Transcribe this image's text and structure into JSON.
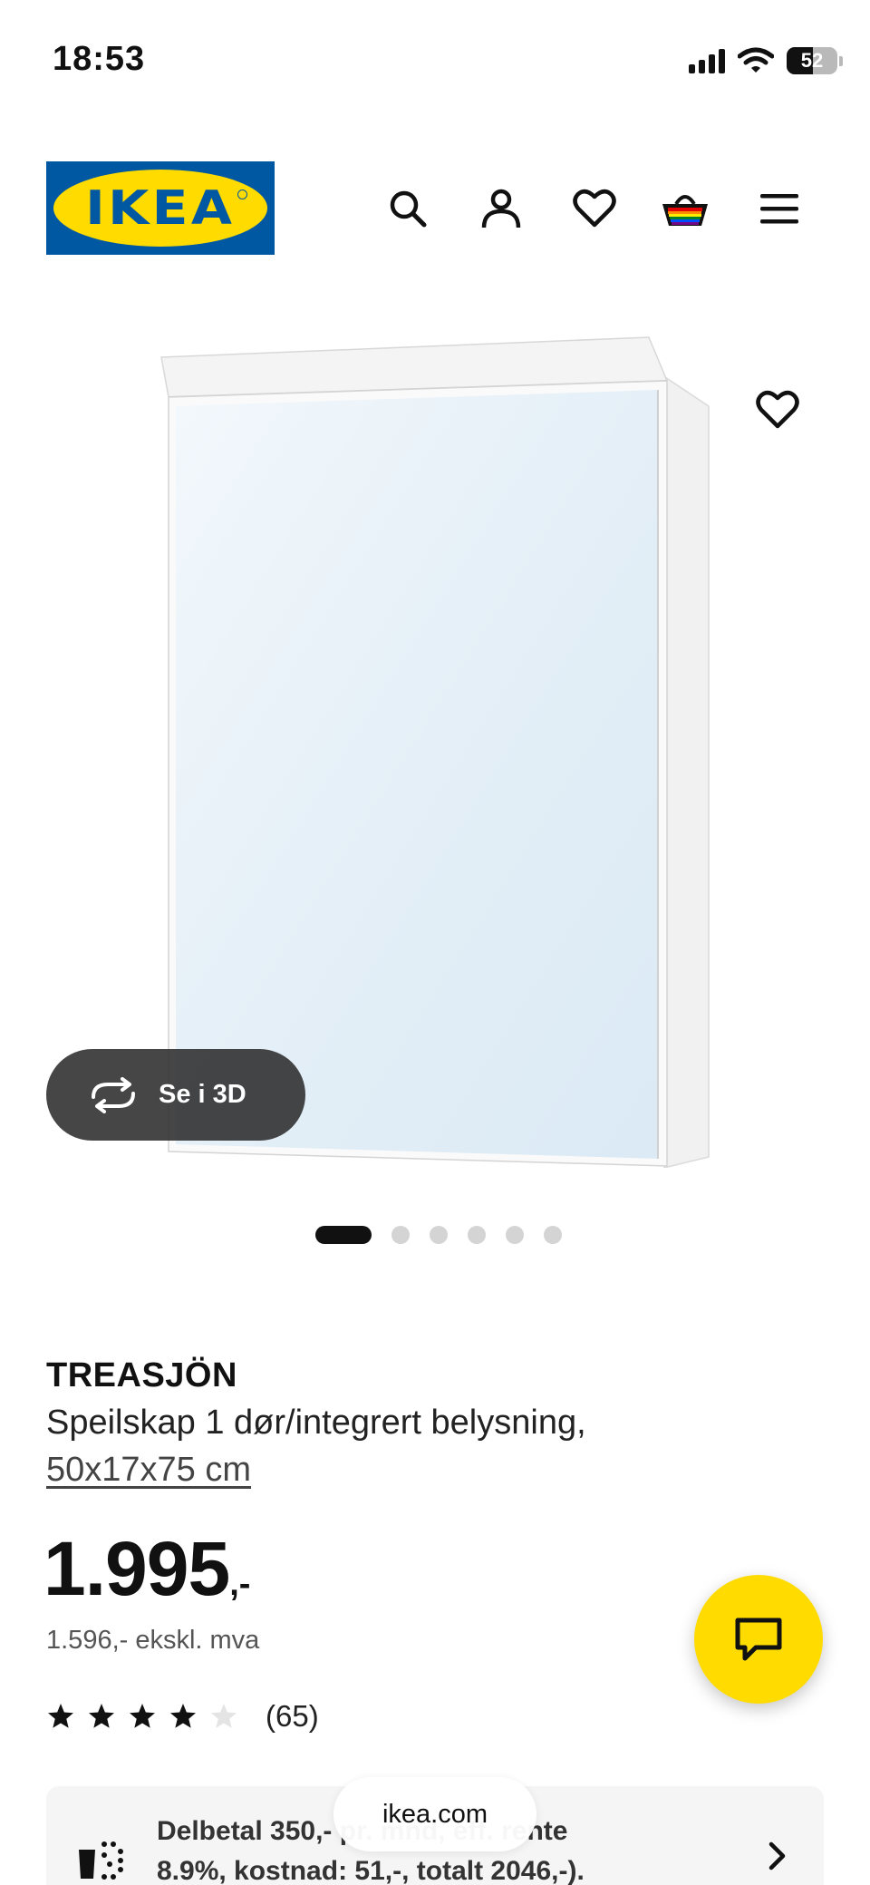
{
  "status_bar": {
    "time": "18:53",
    "battery": "52"
  },
  "header": {
    "logo_text": "IKEA",
    "icons": [
      "search-icon",
      "account-icon",
      "heart-icon",
      "basket-icon",
      "menu-icon"
    ]
  },
  "gallery": {
    "view_3d_label": "Se i 3D",
    "image_count": 6,
    "active_index": 0
  },
  "product": {
    "name": "TREASJÖN",
    "description": "Speilskap 1 dør/integrert belysning,",
    "size": "50x17x75 cm",
    "price": "1.995",
    "price_suffix": ",-",
    "price_ex_vat": "1.596,- ekskl. mva",
    "rating": 4,
    "rating_max": 5,
    "review_count": "(65)"
  },
  "finance": {
    "line1": "Delbetal 350,- pr. mnd, eff. rente",
    "line2": "8.9%, kostnad: 51,-, totalt 2046,-)."
  },
  "browser": {
    "url": "ikea.com"
  },
  "colors": {
    "ikea_blue": "#0058A3",
    "ikea_yellow": "#FFDB00",
    "text": "#111111"
  }
}
